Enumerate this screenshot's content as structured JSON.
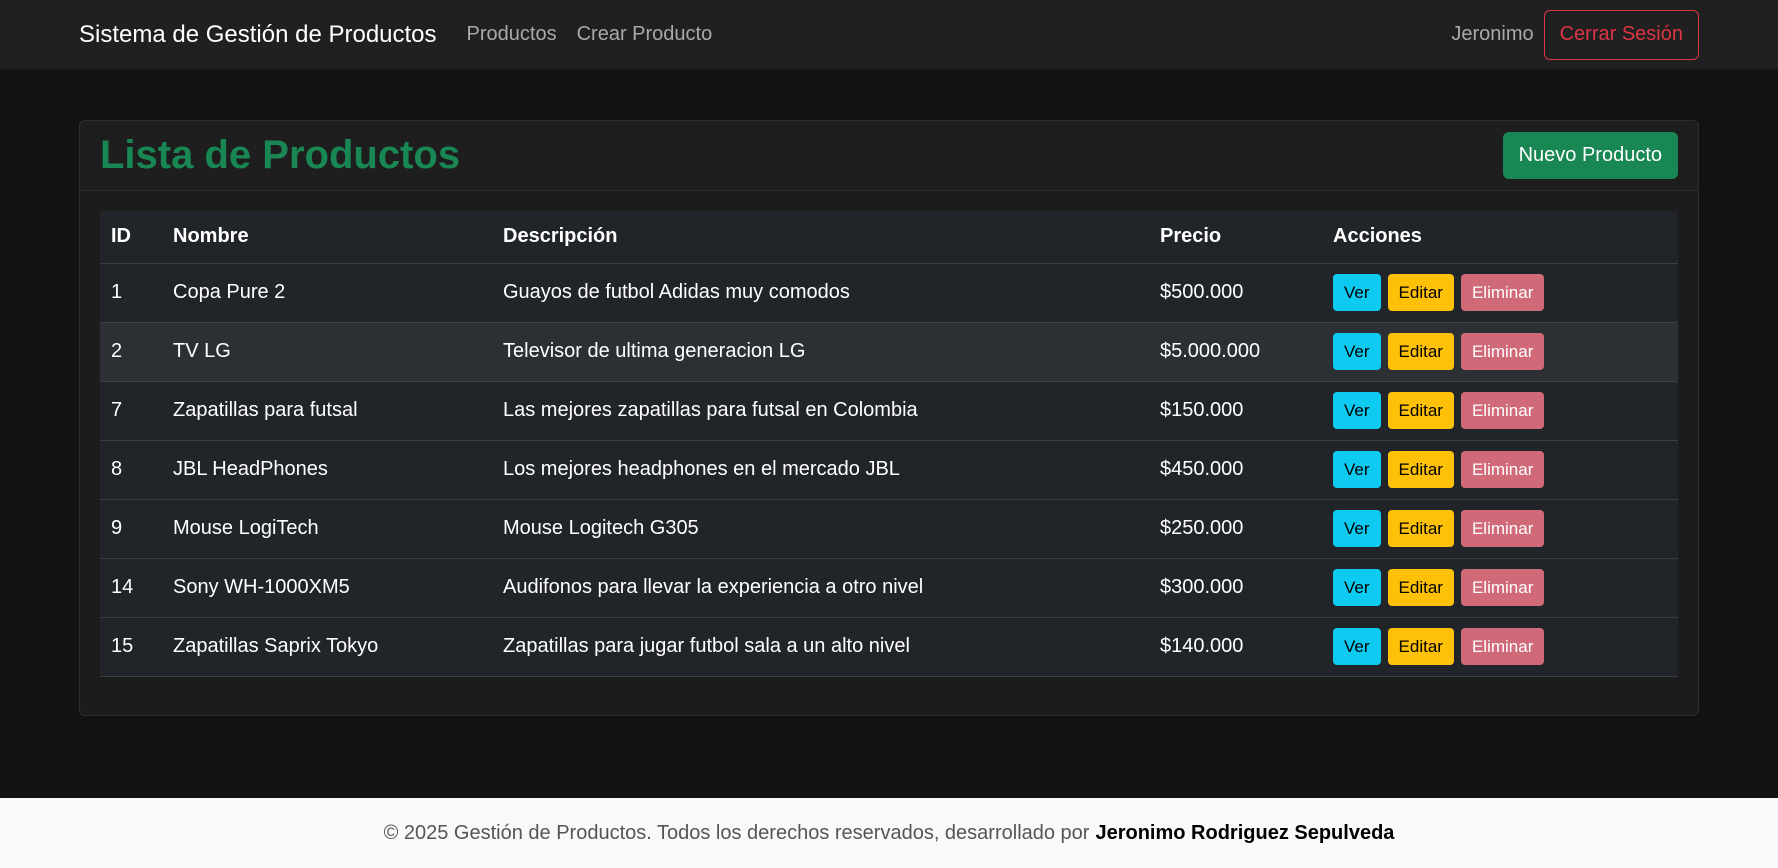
{
  "navbar": {
    "brand": "Sistema de Gestión de Productos",
    "links": [
      "Productos",
      "Crear Producto"
    ],
    "user": "Jeronimo",
    "logout_label": "Cerrar Sesión"
  },
  "card": {
    "title": "Lista de Productos",
    "new_button": "Nuevo Producto"
  },
  "table": {
    "headers": [
      "ID",
      "Nombre",
      "Descripción",
      "Precio",
      "Acciones"
    ],
    "actions": {
      "view": "Ver",
      "edit": "Editar",
      "delete": "Eliminar"
    },
    "rows": [
      {
        "id": "1",
        "name": "Copa Pure 2",
        "description": "Guayos de futbol Adidas muy comodos",
        "price": "$500.000"
      },
      {
        "id": "2",
        "name": "TV LG",
        "description": "Televisor de ultima generacion LG",
        "price": "$5.000.000"
      },
      {
        "id": "7",
        "name": "Zapatillas para futsal",
        "description": "Las mejores zapatillas para futsal en Colombia",
        "price": "$150.000"
      },
      {
        "id": "8",
        "name": "JBL HeadPhones",
        "description": "Los mejores headphones en el mercado JBL",
        "price": "$450.000"
      },
      {
        "id": "9",
        "name": "Mouse LogiTech",
        "description": "Mouse Logitech G305",
        "price": "$250.000"
      },
      {
        "id": "14",
        "name": "Sony WH-1000XM5",
        "description": "Audifonos para llevar la experiencia a otro nivel",
        "price": "$300.000"
      },
      {
        "id": "15",
        "name": "Zapatillas Saprix Tokyo",
        "description": "Zapatillas para jugar futbol sala a un alto nivel",
        "price": "$140.000"
      }
    ]
  },
  "footer": {
    "text": "© 2025 Gestión de Productos. Todos los derechos reservados, desarrollado por",
    "author": "Jeronimo Rodriguez Sepulveda"
  },
  "colors": {
    "primary_green": "#198754",
    "info": "#0dcaf0",
    "warning": "#ffc107",
    "danger": "#dc3545"
  }
}
